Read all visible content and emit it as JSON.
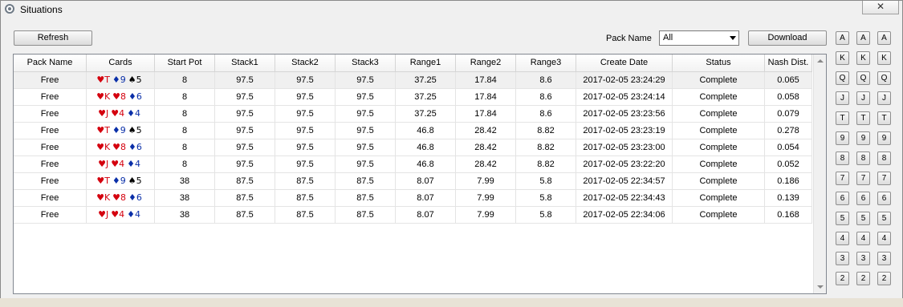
{
  "window": {
    "title": "Situations",
    "close_label": "✕"
  },
  "toolbar": {
    "refresh_label": "Refresh",
    "pack_name_label": "Pack Name",
    "pack_name_value": "All",
    "download_label": "Download"
  },
  "table": {
    "columns": [
      "Pack Name",
      "Cards",
      "Start Pot",
      "Stack1",
      "Stack2",
      "Stack3",
      "Range1",
      "Range2",
      "Range3",
      "Create Date",
      "Status",
      "Nash Dist."
    ],
    "rows": [
      {
        "pack": "Free",
        "cards": [
          {
            "s": "♥",
            "r": "T",
            "c": "red"
          },
          {
            "s": "♦",
            "r": "9",
            "c": "blue"
          },
          {
            "s": "♠",
            "r": "5",
            "c": "black"
          }
        ],
        "start_pot": "8",
        "stack1": "97.5",
        "stack2": "97.5",
        "stack3": "97.5",
        "range1": "37.25",
        "range2": "17.84",
        "range3": "8.6",
        "date": "2017-02-05 23:24:29",
        "status": "Complete",
        "nash": "0.065"
      },
      {
        "pack": "Free",
        "cards": [
          {
            "s": "♥",
            "r": "K",
            "c": "red"
          },
          {
            "s": "♥",
            "r": "8",
            "c": "red"
          },
          {
            "s": "♦",
            "r": "6",
            "c": "blue"
          }
        ],
        "start_pot": "8",
        "stack1": "97.5",
        "stack2": "97.5",
        "stack3": "97.5",
        "range1": "37.25",
        "range2": "17.84",
        "range3": "8.6",
        "date": "2017-02-05 23:24:14",
        "status": "Complete",
        "nash": "0.058"
      },
      {
        "pack": "Free",
        "cards": [
          {
            "s": "♥",
            "r": "J",
            "c": "red"
          },
          {
            "s": "♥",
            "r": "4",
            "c": "red"
          },
          {
            "s": "♦",
            "r": "4",
            "c": "blue"
          }
        ],
        "start_pot": "8",
        "stack1": "97.5",
        "stack2": "97.5",
        "stack3": "97.5",
        "range1": "37.25",
        "range2": "17.84",
        "range3": "8.6",
        "date": "2017-02-05 23:23:56",
        "status": "Complete",
        "nash": "0.079"
      },
      {
        "pack": "Free",
        "cards": [
          {
            "s": "♥",
            "r": "T",
            "c": "red"
          },
          {
            "s": "♦",
            "r": "9",
            "c": "blue"
          },
          {
            "s": "♠",
            "r": "5",
            "c": "black"
          }
        ],
        "start_pot": "8",
        "stack1": "97.5",
        "stack2": "97.5",
        "stack3": "97.5",
        "range1": "46.8",
        "range2": "28.42",
        "range3": "8.82",
        "date": "2017-02-05 23:23:19",
        "status": "Complete",
        "nash": "0.278"
      },
      {
        "pack": "Free",
        "cards": [
          {
            "s": "♥",
            "r": "K",
            "c": "red"
          },
          {
            "s": "♥",
            "r": "8",
            "c": "red"
          },
          {
            "s": "♦",
            "r": "6",
            "c": "blue"
          }
        ],
        "start_pot": "8",
        "stack1": "97.5",
        "stack2": "97.5",
        "stack3": "97.5",
        "range1": "46.8",
        "range2": "28.42",
        "range3": "8.82",
        "date": "2017-02-05 23:23:00",
        "status": "Complete",
        "nash": "0.054"
      },
      {
        "pack": "Free",
        "cards": [
          {
            "s": "♥",
            "r": "J",
            "c": "red"
          },
          {
            "s": "♥",
            "r": "4",
            "c": "red"
          },
          {
            "s": "♦",
            "r": "4",
            "c": "blue"
          }
        ],
        "start_pot": "8",
        "stack1": "97.5",
        "stack2": "97.5",
        "stack3": "97.5",
        "range1": "46.8",
        "range2": "28.42",
        "range3": "8.82",
        "date": "2017-02-05 23:22:20",
        "status": "Complete",
        "nash": "0.052"
      },
      {
        "pack": "Free",
        "cards": [
          {
            "s": "♥",
            "r": "T",
            "c": "red"
          },
          {
            "s": "♦",
            "r": "9",
            "c": "blue"
          },
          {
            "s": "♠",
            "r": "5",
            "c": "black"
          }
        ],
        "start_pot": "38",
        "stack1": "87.5",
        "stack2": "87.5",
        "stack3": "87.5",
        "range1": "8.07",
        "range2": "7.99",
        "range3": "5.8",
        "date": "2017-02-05 22:34:57",
        "status": "Complete",
        "nash": "0.186"
      },
      {
        "pack": "Free",
        "cards": [
          {
            "s": "♥",
            "r": "K",
            "c": "red"
          },
          {
            "s": "♥",
            "r": "8",
            "c": "red"
          },
          {
            "s": "♦",
            "r": "6",
            "c": "blue"
          }
        ],
        "start_pot": "38",
        "stack1": "87.5",
        "stack2": "87.5",
        "stack3": "87.5",
        "range1": "8.07",
        "range2": "7.99",
        "range3": "5.8",
        "date": "2017-02-05 22:34:43",
        "status": "Complete",
        "nash": "0.139"
      },
      {
        "pack": "Free",
        "cards": [
          {
            "s": "♥",
            "r": "J",
            "c": "red"
          },
          {
            "s": "♥",
            "r": "4",
            "c": "red"
          },
          {
            "s": "♦",
            "r": "4",
            "c": "blue"
          }
        ],
        "start_pot": "38",
        "stack1": "87.5",
        "stack2": "87.5",
        "stack3": "87.5",
        "range1": "8.07",
        "range2": "7.99",
        "range3": "5.8",
        "date": "2017-02-05 22:34:06",
        "status": "Complete",
        "nash": "0.168"
      }
    ]
  },
  "rank_buttons": [
    "A",
    "K",
    "Q",
    "J",
    "T",
    "9",
    "8",
    "7",
    "6",
    "5",
    "4",
    "3",
    "2"
  ],
  "colors": {
    "red": "#d4000e",
    "blue": "#0a2fa8",
    "black": "#000000"
  }
}
